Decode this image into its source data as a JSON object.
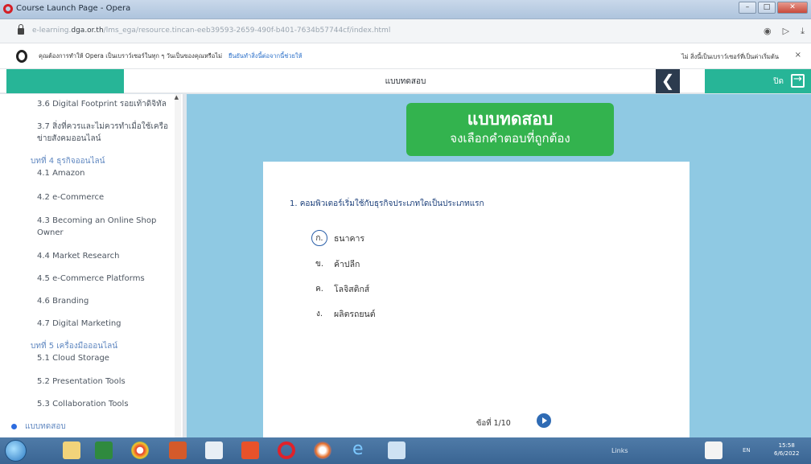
{
  "window": {
    "title": "Course Launch Page - Opera",
    "controls": {
      "minimize": "–",
      "maximize": "□",
      "close": "✕"
    }
  },
  "address_bar": {
    "url_prefix": "e-learning.",
    "url_domain": "dga.or.th",
    "url_path": "/lms_ega/resource.tincan-eeb39593-2659-490f-b401-7634b57744cf/index.html",
    "icons": [
      "shield-icon",
      "send-icon",
      "download-icon"
    ]
  },
  "info_bar": {
    "text": "คุณต้องการทำให้ Opera เป็นเบราว์เซอร์ในทุก ๆ วันเป็นของคุณหรือไม่",
    "link": "ยืนยันทำสิ่งนี้ต่อจากนี้ช่วยให้",
    "right_text": "ไม่ สิ่งนี้เป็นเบราว์เซอร์ที่เป็นค่าเริ่มต้น",
    "close": "×"
  },
  "course_header": {
    "title": "แบบทดสอบ",
    "back_glyph": "❮",
    "close_label": "ปิด"
  },
  "sidebar": {
    "items": [
      {
        "type": "item",
        "label": "3.6 Digital Footprint รอยเท้าดิจิทัล"
      },
      {
        "type": "wrap",
        "label": "3.7 สิ่งที่ควรและไม่ควรทำเมื่อใช้เครือข่ายสังคมออนไลน์"
      },
      {
        "type": "chapter",
        "label": "บทที่ 4 ธุรกิจออนไลน์",
        "sub": "4.1 Amazon"
      },
      {
        "type": "item",
        "label": "4.2 e-Commerce"
      },
      {
        "type": "wrap",
        "label": "4.3 Becoming an Online Shop Owner"
      },
      {
        "type": "item",
        "label": "4.4 Market Research"
      },
      {
        "type": "item",
        "label": "4.5 e-Commerce Platforms"
      },
      {
        "type": "item",
        "label": "4.6 Branding"
      },
      {
        "type": "item",
        "label": "4.7 Digital Marketing"
      },
      {
        "type": "chapter",
        "label": "บทที่ 5 เครื่องมือออนไลน์",
        "sub": "5.1 Cloud Storage"
      },
      {
        "type": "item",
        "label": "5.2 Presentation Tools"
      },
      {
        "type": "item",
        "label": "5.3 Collaboration Tools"
      }
    ],
    "current": "แบบทดสอบ"
  },
  "quiz": {
    "banner_title": "แบบทดสอบ",
    "banner_subtitle": "จงเลือกคำตอบที่ถูกต้อง",
    "question": "1. คอมพิวเตอร์เริ่มใช้กับธุรกิจประเภทใดเป็นประเภทแรก",
    "choices": [
      {
        "key": "ก.",
        "text": "ธนาคาร",
        "selected": true
      },
      {
        "key": "ข.",
        "text": "ค้าปลีก",
        "selected": false
      },
      {
        "key": "ค.",
        "text": "โลจิสติกส์",
        "selected": false
      },
      {
        "key": "ง.",
        "text": "ผลิตรถยนต์",
        "selected": false
      }
    ],
    "pager": "ข้อที่ 1/10"
  },
  "taskbar": {
    "links_label": "Links",
    "lang": "EN",
    "time": "15:58",
    "date": "6/6/2022"
  },
  "colors": {
    "accent_green": "#27b597",
    "quiz_bg": "#8fc9e3",
    "banner_green": "#33b34e",
    "nav_dark": "#2c3b4e"
  }
}
